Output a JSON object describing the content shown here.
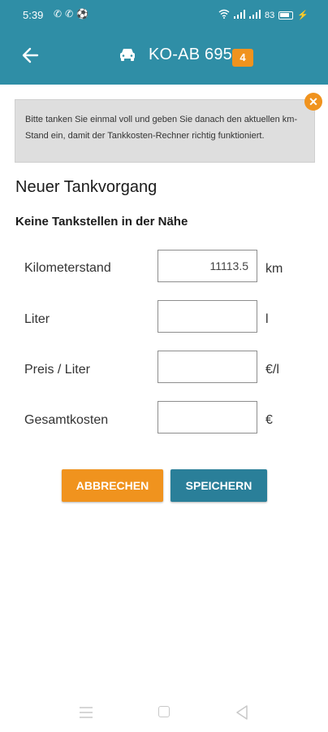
{
  "status_bar": {
    "time": "5:39",
    "left_icons": [
      "phone-icon",
      "wifi-call-icon",
      "soccer-icon"
    ],
    "right_info": "83"
  },
  "app_bar": {
    "plate": "KO-AB 695",
    "badge": "4",
    "accent": "#2f8ea6"
  },
  "notice": {
    "text": "Bitte tanken Sie einmal voll und geben Sie danach den aktuellen km-Stand ein, damit der Tankkosten-Rechner richtig funktioniert."
  },
  "form": {
    "title": "Neuer Tankvorgang",
    "subtitle": "Keine Tankstellen in der Nähe",
    "rows": [
      {
        "label": "Kilometerstand",
        "value": "11113.5",
        "unit": "km"
      },
      {
        "label": "Liter",
        "value": "",
        "unit": "l"
      },
      {
        "label": "Preis / Liter",
        "value": "",
        "unit": "€/l"
      },
      {
        "label": "Gesamtkosten",
        "value": "",
        "unit": "€"
      }
    ]
  },
  "buttons": {
    "cancel": "ABBRECHEN",
    "save": "SPEICHERN",
    "cancel_color": "#f0931e",
    "save_color": "#2a7f99"
  },
  "nav": {
    "icons": [
      "menu-icon",
      "home-icon",
      "back-triangle-icon"
    ]
  }
}
